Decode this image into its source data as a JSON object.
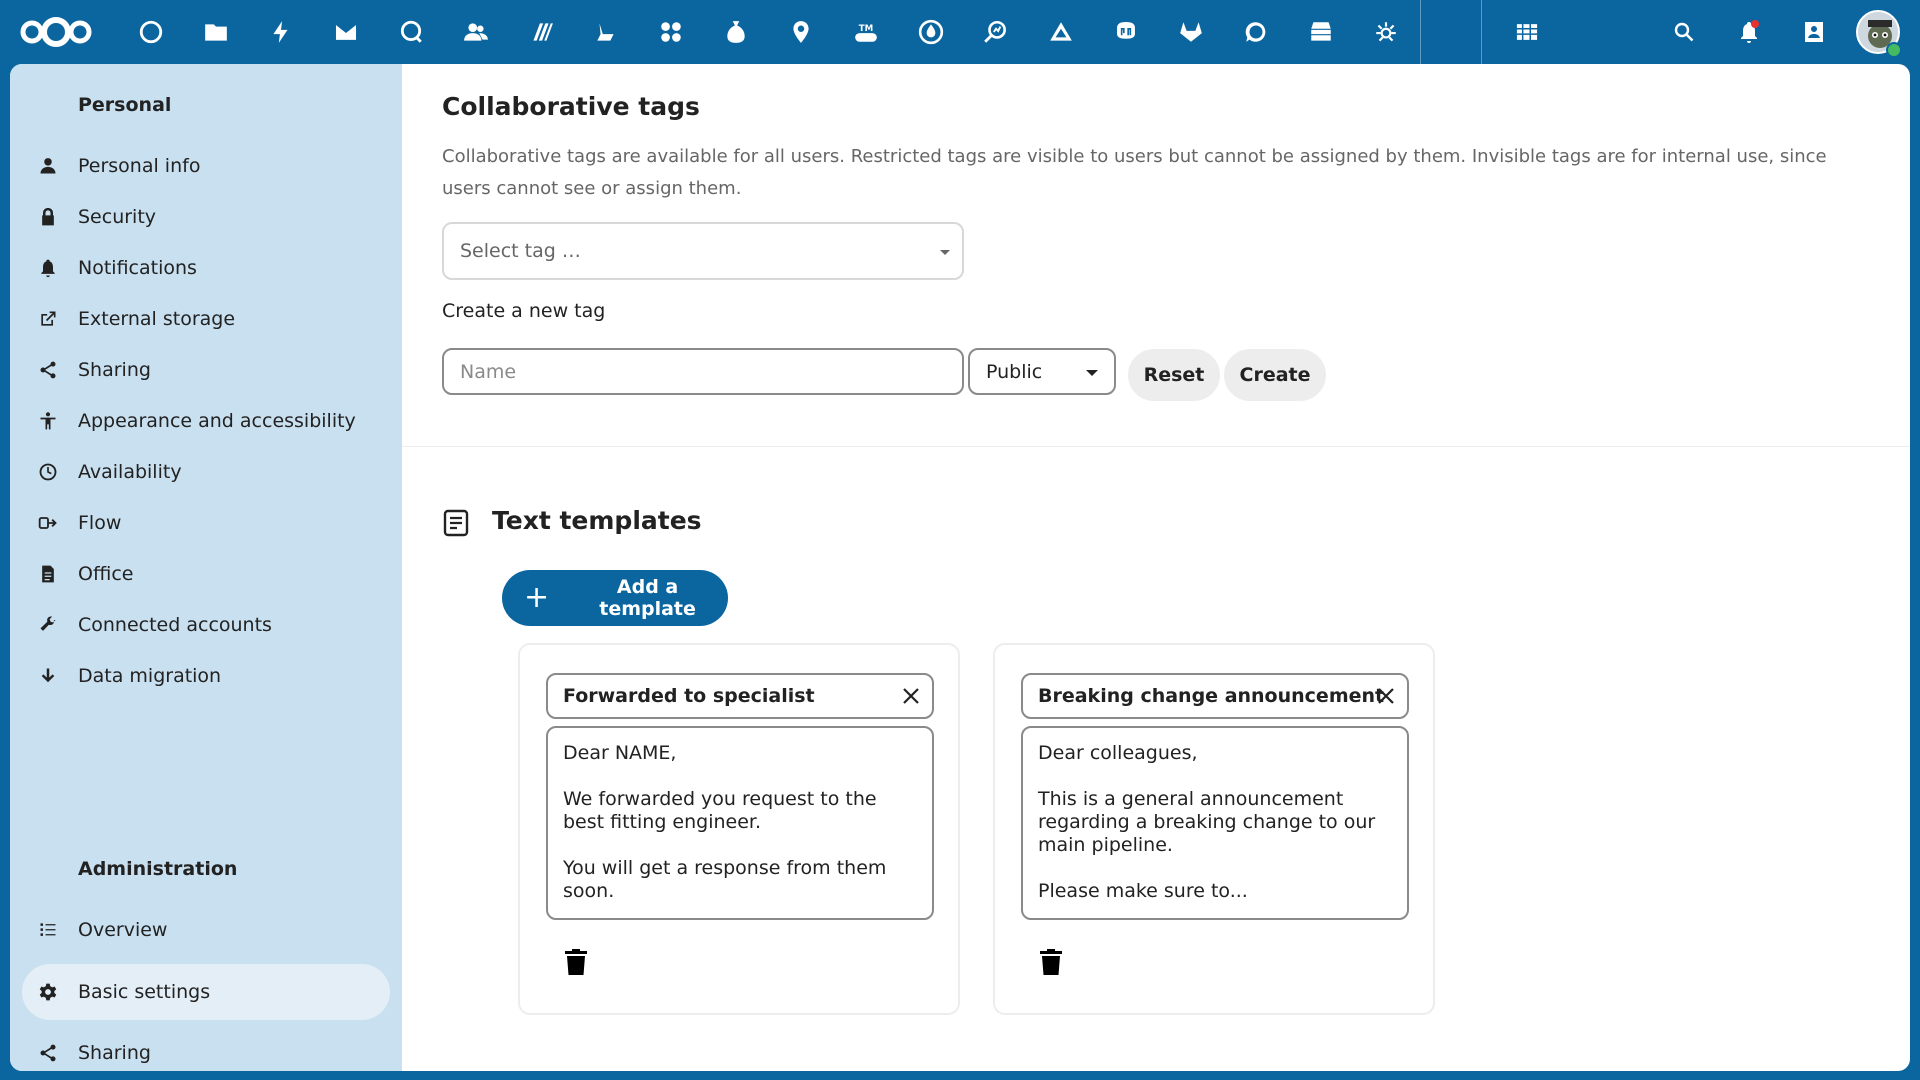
{
  "header": {
    "app_icons": [
      "dashboard-icon",
      "files-icon",
      "activity-icon",
      "mail-icon",
      "talk-icon",
      "contacts-icon",
      "deck-icon",
      "tasks-icon",
      "apps-icon",
      "money-icon",
      "maps-icon",
      "tmdb-icon",
      "cospend-icon",
      "analytics-icon",
      "drive-icon",
      "mastodon-icon",
      "gitlab-icon",
      "chat-icon",
      "stack-icon",
      "weather-icon",
      "blank-app-icon",
      "tables-icon"
    ],
    "right_icons": [
      "search-icon",
      "notifications-icon",
      "contacts-menu-icon",
      "avatar"
    ],
    "colors": {
      "brand": "#0b66a0",
      "notification": "#e9322d",
      "online": "#46ba61"
    }
  },
  "sidebar": {
    "personal_heading": "Personal",
    "personal_items": [
      {
        "label": "Personal info",
        "icon": "user-icon"
      },
      {
        "label": "Security",
        "icon": "lock-icon"
      },
      {
        "label": "Notifications",
        "icon": "bell-icon"
      },
      {
        "label": "External storage",
        "icon": "external-link-icon"
      },
      {
        "label": "Sharing",
        "icon": "share-icon"
      },
      {
        "label": "Appearance and accessibility",
        "icon": "accessibility-icon"
      },
      {
        "label": "Availability",
        "icon": "clock-icon"
      },
      {
        "label": "Flow",
        "icon": "flow-icon"
      },
      {
        "label": "Office",
        "icon": "document-icon"
      },
      {
        "label": "Connected accounts",
        "icon": "wrench-icon"
      },
      {
        "label": "Data migration",
        "icon": "download-icon"
      }
    ],
    "admin_heading": "Administration",
    "admin_items": [
      {
        "label": "Overview",
        "icon": "list-icon"
      },
      {
        "label": "Basic settings",
        "icon": "gear-icon",
        "active": true
      },
      {
        "label": "Sharing",
        "icon": "share-icon"
      }
    ]
  },
  "tags": {
    "title": "Collaborative tags",
    "description": "Collaborative tags are available for all users. Restricted tags are visible to users but cannot be assigned by them. Invisible tags are for internal use, since users cannot see or assign them.",
    "select_placeholder": "Select tag …",
    "create_label": "Create a new tag",
    "name_placeholder": "Name",
    "visibility": "Public",
    "reset_label": "Reset",
    "create_button": "Create"
  },
  "templates": {
    "title": "Text templates",
    "add_label": "Add a template",
    "items": [
      {
        "title": "Forwarded to specialist",
        "body": "Dear NAME,\n\nWe forwarded you request to the best fitting engineer.\n\nYou will get a response from them soon."
      },
      {
        "title": "Breaking change announcement",
        "body": "Dear colleagues,\n\nThis is a general announcement regarding a breaking change to our main pipeline.\n\nPlease make sure to..."
      }
    ]
  }
}
